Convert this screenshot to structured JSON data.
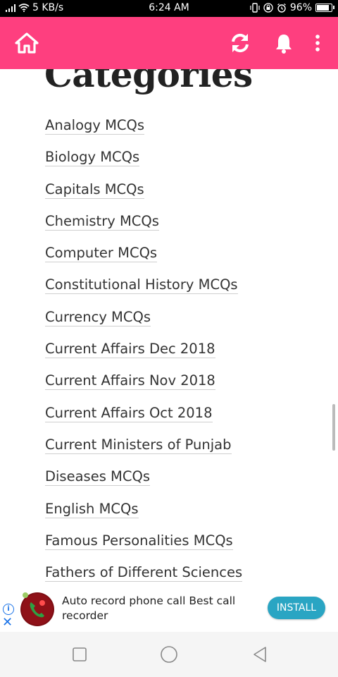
{
  "status_bar": {
    "speed": "5 KB/s",
    "time": "6:24 AM",
    "battery": "96%",
    "battery_level": 0.96
  },
  "app_bar": {
    "color": "#fe3f7f",
    "icons": [
      "home-icon",
      "refresh-icon",
      "bell-icon",
      "more-vert-icon"
    ]
  },
  "page": {
    "heading": "Categories",
    "categories": [
      "Analogy MCQs",
      "Biology MCQs",
      "Capitals MCQs",
      "Chemistry MCQs",
      "Computer MCQs",
      "Constitutional History MCQs",
      "Currency MCQs",
      "Current Affairs Dec 2018",
      "Current Affairs Nov 2018",
      "Current Affairs Oct 2018",
      "Current Ministers of Punjab",
      "Diseases MCQs",
      "English MCQs",
      "Famous Personalities MCQs",
      "Fathers of Different Sciences"
    ]
  },
  "ad": {
    "text": "Auto record phone call Best call recorder",
    "install_label": "INSTALL",
    "install_color": "#2aa5c3"
  },
  "nav_bar": {
    "icons": [
      "recents-square-icon",
      "home-circle-icon",
      "back-triangle-icon"
    ]
  }
}
